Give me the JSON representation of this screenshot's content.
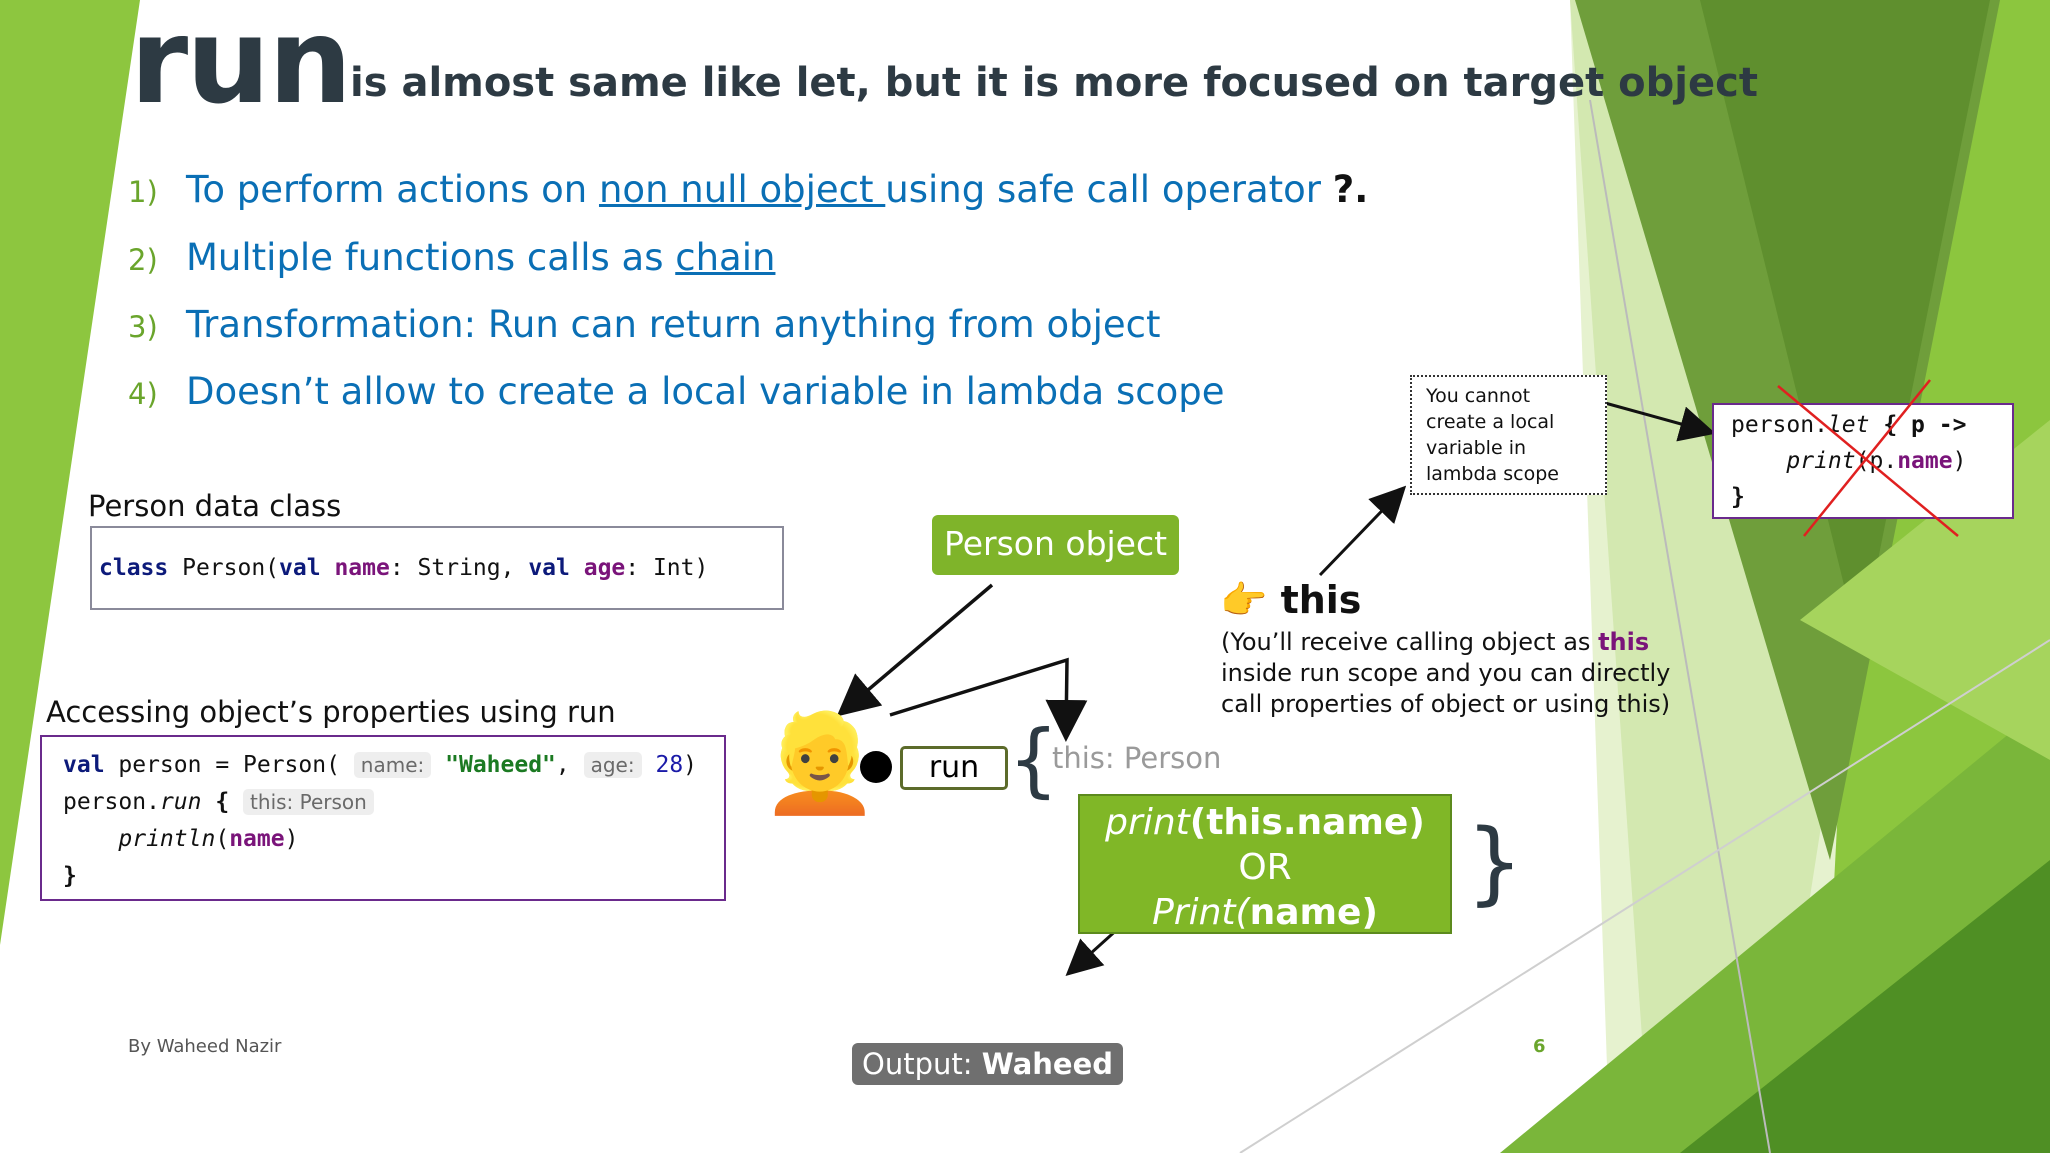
{
  "slide": {
    "title_keyword": "run",
    "title_text": "is almost same like let, but it is more focused on target object",
    "bullets": [
      {
        "num": "1)",
        "before": "To perform actions on ",
        "link": "non null object ",
        "after": "using safe call operator ",
        "op": "?."
      },
      {
        "num": "2)",
        "before": "Multiple functions calls as ",
        "link": "chain"
      },
      {
        "num": "3)",
        "before": "Transformation: Run can return anything from object"
      },
      {
        "num": "4)",
        "before": "Doesn’t allow to create a local variable in lambda scope"
      }
    ],
    "person_class": {
      "label": "Person data class",
      "code": {
        "kw1": "class",
        "t1": " Person(",
        "kw2": "val",
        "p1": "name",
        "t2": ": String, ",
        "kw3": "val",
        "p2": "age",
        "t3": ": Int)"
      }
    },
    "access": {
      "label": "Accessing object’s properties using run",
      "line1": {
        "kw": "val",
        "t1": " person = Person( ",
        "hint_name": "name:",
        "str": "\"Waheed\"",
        "t2": ", ",
        "hint_age": "age:",
        "num": "28",
        "t3": ")"
      },
      "line2": {
        "t1": "person.",
        "fn": "run",
        "t2": " {",
        "hint": "this: Person"
      },
      "line3": {
        "fn": "println",
        "t1": "(",
        "prop": "name",
        "t2": ")"
      },
      "line4": "}"
    },
    "diagram": {
      "person_object_label": "Person object",
      "avatar_emoji": "👱",
      "run_label": "run",
      "brace_open": "{",
      "brace_close": "}",
      "this_type_label": "this: Person",
      "result_line1_fn": "print",
      "result_line1_rest": "(this.name)",
      "result_line2": "OR",
      "result_line3_fn": "Print(",
      "result_line3_rest": "name)",
      "output_prefix": "Output: ",
      "output_value": "Waheed"
    },
    "this_info": {
      "pointer_emoji": "👉",
      "heading": "this",
      "desc_before": "(You’ll receive calling object as ",
      "desc_keyword": "this",
      "desc_after": " inside run scope and you can directly call properties of object or using this)"
    },
    "note": {
      "text": "You cannot create a local variable in lambda scope"
    },
    "let_example": {
      "line1_a": "person.",
      "line1_fn": "let",
      "line1_b": " { p ->",
      "line2_fn": "print",
      "line2_a": "(p.",
      "line2_prop": "name",
      "line2_b": ")",
      "line3": "}"
    },
    "footer": {
      "author": "By Waheed Nazir",
      "page": "6"
    },
    "colors": {
      "accent_green": "#80b727",
      "bullet_blue": "#0a6fb5",
      "title_dark": "#2d3a43",
      "keyword_purple": "#7a147a",
      "cross_red": "#e02020"
    }
  }
}
